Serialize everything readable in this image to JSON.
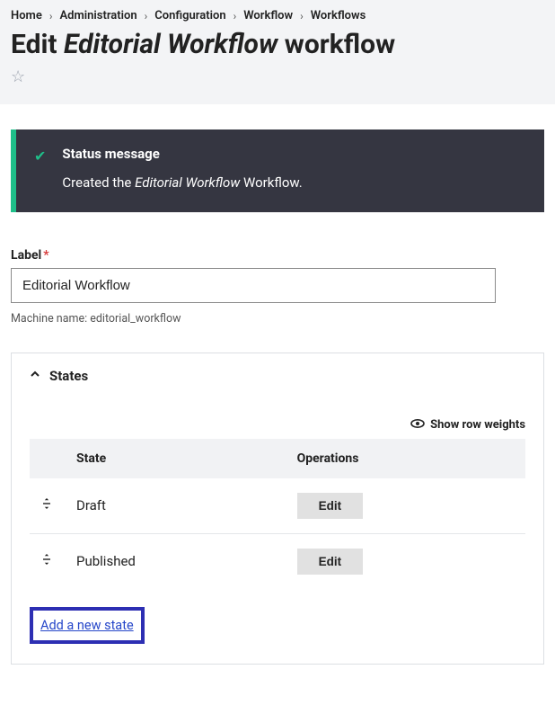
{
  "breadcrumb": {
    "items": [
      "Home",
      "Administration",
      "Configuration",
      "Workflow",
      "Workflows"
    ]
  },
  "page_title": {
    "prefix": "Edit ",
    "em": "Editorial Workflow",
    "suffix": " workflow"
  },
  "status": {
    "heading": "Status message",
    "prefix": "Created the ",
    "em": "Editorial Workflow",
    "suffix": " Workflow."
  },
  "form": {
    "label_text": "Label",
    "required_mark": "*",
    "label_value": "Editorial Workflow",
    "machine_name_label": "Machine name: ",
    "machine_name_value": "editorial_workflow"
  },
  "states_section": {
    "summary": "States",
    "show_weights": "Show row weights",
    "table": {
      "headers": {
        "state": "State",
        "operations": "Operations"
      },
      "rows": [
        {
          "name": "Draft",
          "op_label": "Edit"
        },
        {
          "name": "Published",
          "op_label": "Edit"
        }
      ]
    },
    "add_link": "Add a new state"
  }
}
